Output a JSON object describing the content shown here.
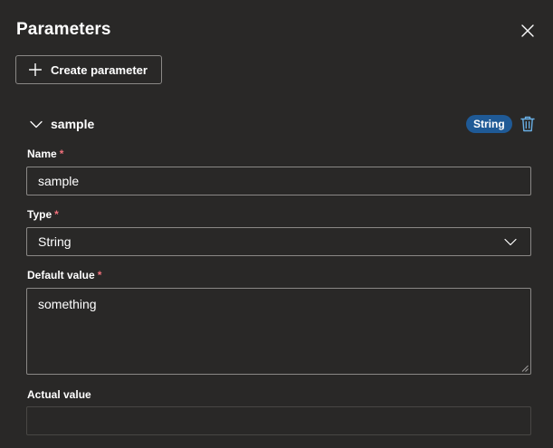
{
  "panel": {
    "title": "Parameters",
    "close_icon": "close-icon",
    "create_button_label": "Create parameter",
    "create_icon": "plus-icon"
  },
  "parameter": {
    "name": "sample",
    "type_badge": "String",
    "expand_icon": "chevron-down-icon",
    "delete_icon": "trash-icon",
    "badge_color": "#1f5a96"
  },
  "fields": {
    "name_label": "Name",
    "name_value": "sample",
    "type_label": "Type",
    "type_value": "String",
    "default_label": "Default value",
    "default_value": "something",
    "actual_label": "Actual value",
    "actual_value": "",
    "required_marker": "*"
  },
  "colors": {
    "background": "#292827",
    "border": "#8a8886",
    "required": "#f1707b",
    "accent": "#69afe5"
  }
}
